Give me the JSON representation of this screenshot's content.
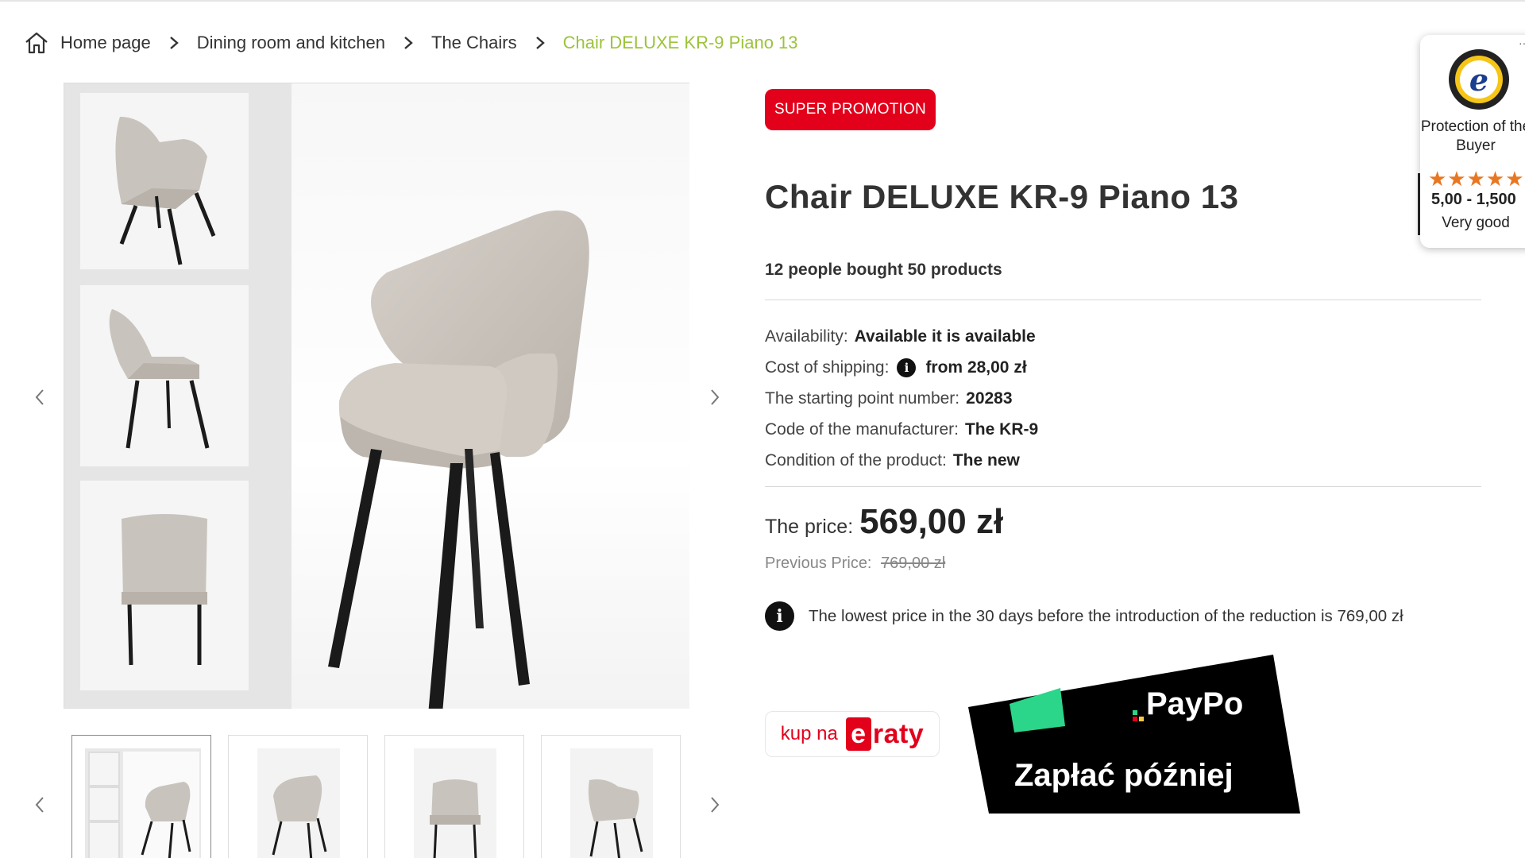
{
  "breadcrumb": {
    "items": [
      "Home page",
      "Dining room and kitchen",
      "The Chairs"
    ],
    "current": "Chair DELUXE KR-9 Piano 13"
  },
  "product": {
    "badge": "SUPER PROMOTION",
    "title": "Chair DELUXE KR-9 Piano 13",
    "bought": "12 people bought 50 products",
    "specs": [
      {
        "label": "Availability:",
        "value": "Available it is available"
      },
      {
        "label": "Cost of shipping:",
        "value": "from 28,00 zł"
      },
      {
        "label": "The starting point number:",
        "value": "20283"
      },
      {
        "label": "Code of the manufacturer:",
        "value": "The KR-9"
      },
      {
        "label": "Condition of the product:",
        "value": "The new"
      }
    ],
    "price_label": "The price:",
    "price": "569,00 zł",
    "previous_label": "Previous Price:",
    "previous_price": "769,00 zł",
    "lowest_note": "The lowest price in the 30 days before the introduction of the reduction is 769,00 zł"
  },
  "payment": {
    "eraty_prefix": "kup na",
    "eraty_initial": "e",
    "eraty_rest": "raty",
    "paypo_brand": "PayPo",
    "paypo_slogan": "Zapłać później"
  },
  "trusted": {
    "more": "···",
    "protection": "Protection of the Buyer",
    "stars": "★★★★★",
    "score": "5,00 - 1,500",
    "verdict": "Very good"
  },
  "colors": {
    "accent_green": "#9cc33b",
    "promo_red": "#e3001b",
    "star_orange": "#e87722",
    "paypo_green": "#2bd68a"
  }
}
